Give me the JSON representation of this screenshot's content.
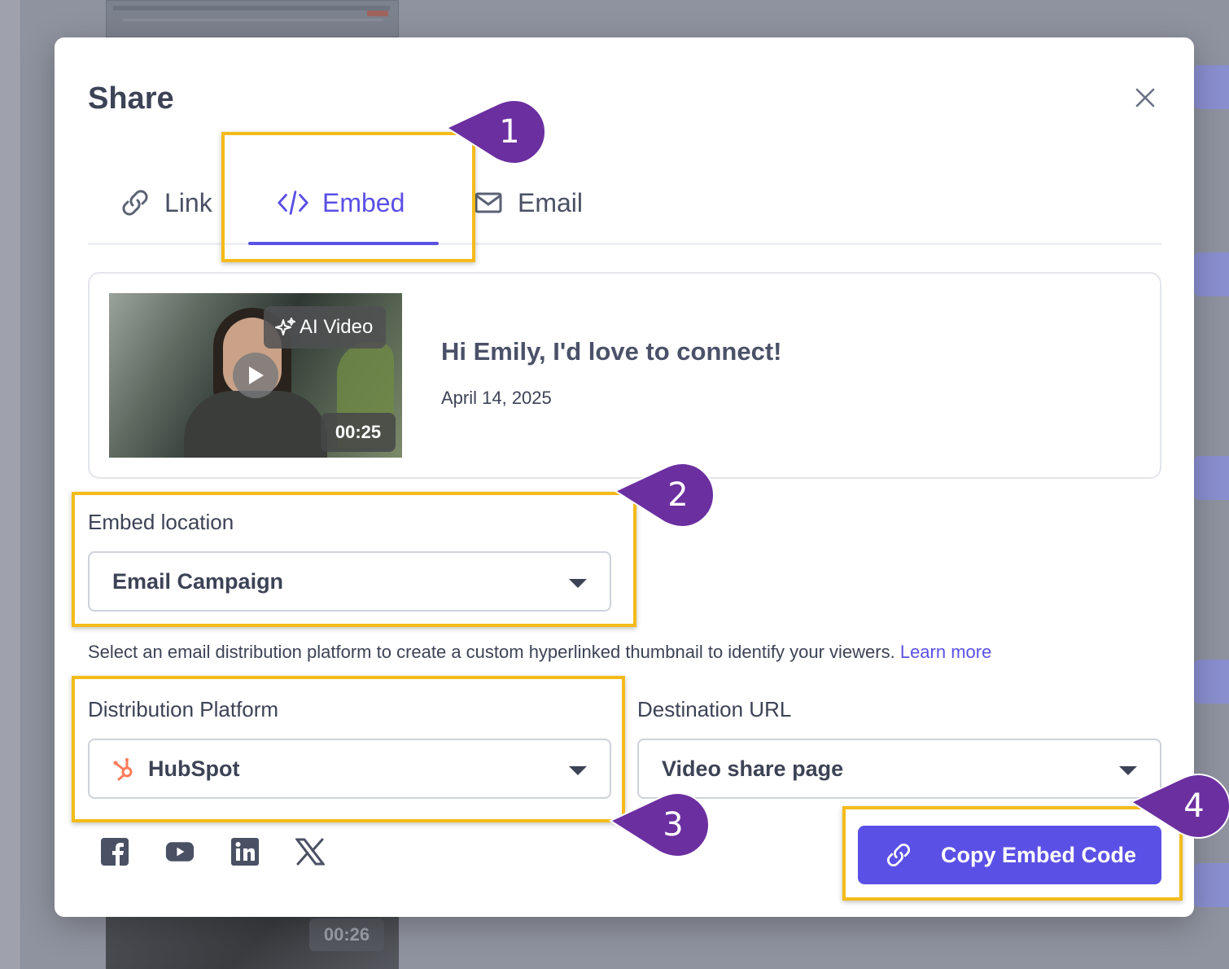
{
  "background": {
    "thumb_duration": "00:26"
  },
  "modal": {
    "title": "Share",
    "close_icon": "close-icon",
    "tabs": [
      {
        "label": "Link",
        "icon": "link-icon"
      },
      {
        "label": "Embed",
        "icon": "code-icon",
        "active": true
      },
      {
        "label": "Email",
        "icon": "envelope-icon"
      }
    ],
    "video": {
      "badge": "AI Video",
      "duration": "00:25",
      "title": "Hi Emily, I'd love to connect!",
      "date": "April 14, 2025"
    },
    "embed_location": {
      "label": "Embed location",
      "value": "Email Campaign"
    },
    "help": {
      "text": "Select an email distribution platform to create a custom hyperlinked thumbnail to identify your viewers.",
      "link": "Learn more"
    },
    "distribution_platform": {
      "label": "Distribution Platform",
      "value": "HubSpot",
      "icon": "hubspot-icon"
    },
    "destination_url": {
      "label": "Destination URL",
      "value": "Video share page"
    },
    "socials": [
      "facebook-icon",
      "youtube-icon",
      "linkedin-icon",
      "x-icon"
    ],
    "copy_button": "Copy Embed Code"
  },
  "annotations": [
    "1",
    "2",
    "3",
    "4"
  ],
  "colors": {
    "accent": "#5b50e6",
    "highlight": "#f4bb1a",
    "callout": "#6b2fa0",
    "hubspot": "#ff7a59"
  }
}
